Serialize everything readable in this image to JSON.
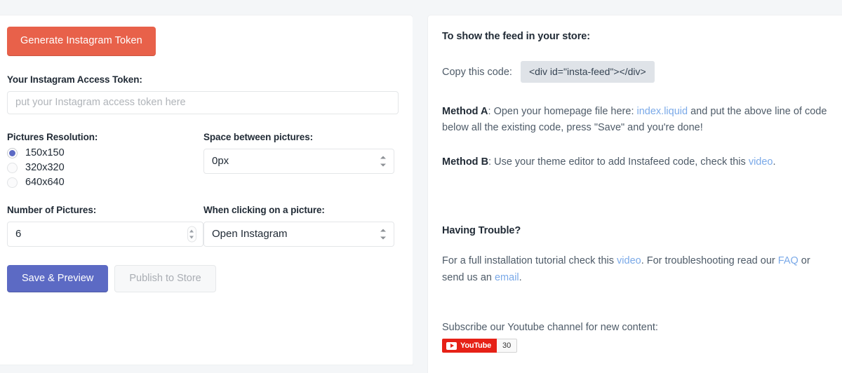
{
  "settings_panel": {
    "generate_token_button": "Generate Instagram Token",
    "token_field": {
      "label": "Your Instagram Access Token:",
      "value": "",
      "placeholder": "put your Instagram access token here"
    },
    "resolution": {
      "label": "Pictures Resolution:",
      "options": [
        "150x150",
        "320x320",
        "640x640"
      ],
      "selected": "150x150"
    },
    "spacing": {
      "label": "Space between pictures:",
      "selected": "0px"
    },
    "number_of_pictures": {
      "label": "Number of Pictures:",
      "value": "6"
    },
    "click_action": {
      "label": "When clicking on a picture:",
      "selected": "Open Instagram"
    },
    "save_preview_button": "Save & Preview",
    "publish_store_button": "Publish to Store"
  },
  "help_panel": {
    "feed_title": "To show the feed in your store:",
    "copy_code_label": "Copy this code:",
    "code_snippet": "<div id=\"insta-feed\"></div>",
    "method_a": {
      "prefix": "Method A",
      "text_1": ": Open your homepage file here: ",
      "link": "index.liquid",
      "text_2": " and put the above line of code below all the existing code, press \"Save\" and you're done!"
    },
    "method_b": {
      "prefix": "Method B",
      "text_1": ": Use your theme editor to add Instafeed code, check this ",
      "link": "video",
      "text_2": "."
    },
    "trouble_title": "Having Trouble?",
    "trouble": {
      "text_1": "For a full installation tutorial check this ",
      "link_video": "video",
      "text_2": ". For troubleshooting read our ",
      "link_faq": "FAQ",
      "text_3": " or send us an ",
      "link_email": "email",
      "text_4": "."
    },
    "subscribe_title": "Subscribe our Youtube channel for new content:",
    "youtube": {
      "label": "YouTube",
      "count": "30"
    }
  },
  "colors": {
    "accent_orange": "#e8614a",
    "accent_indigo": "#5c6ac4",
    "link_blue": "#7aa9e8",
    "code_chip": "#dfe3e8",
    "youtube_red": "#e62117",
    "page_background": "#f4f6f8"
  }
}
